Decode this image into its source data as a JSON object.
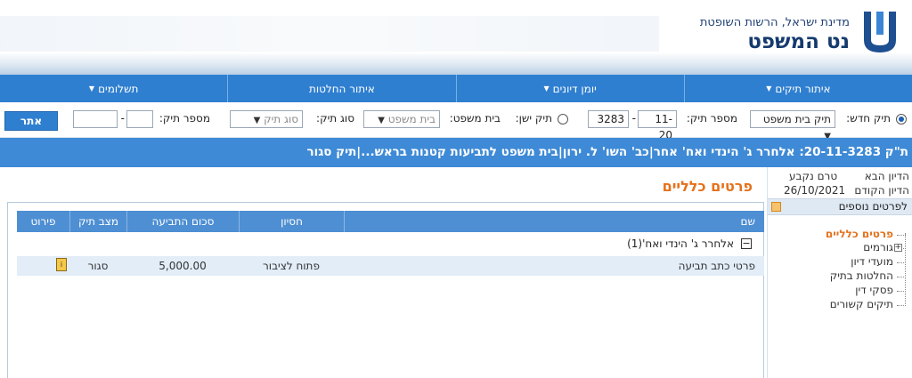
{
  "header": {
    "authority": "מדינת ישראל, הרשות השופטת",
    "site_name": "נט המשפט",
    "logo_icon": "court-logo-icon"
  },
  "nav": {
    "items": [
      {
        "label": "איתור תיקים",
        "dropdown": true
      },
      {
        "label": "יומן דיונים",
        "dropdown": true
      },
      {
        "label": "איתור החלטות",
        "dropdown": false
      },
      {
        "label": "תשלומים",
        "dropdown": true
      }
    ]
  },
  "search": {
    "new_case_label": "תיק חדש:",
    "new_case_selected": true,
    "court_type_value": "תיק בית משפט",
    "case_number_label": "מספר תיק:",
    "case_number_value": "11-20",
    "case_number_suffix": "3283",
    "old_case_label": "תיק ישן:",
    "court_label": "בית משפט:",
    "court_placeholder": "בית משפט",
    "case_type_label": "סוג תיק:",
    "case_type_placeholder": "סוג תיק",
    "case_number2_label": "מספר תיק:",
    "search_button": "אתר"
  },
  "case_bar": {
    "title": "ת\"ק 20-11-3283: אלחרר ג' הינדי ואח' אחר|כב' השו' ל. ירון|בית משפט לתביעות קטנות בראש...|תיק סגור"
  },
  "side": {
    "next_hearing_label": "הדיון הבא",
    "next_hearing_value": "טרם נקבע",
    "prev_hearing_label": "הדיון הקודם",
    "prev_hearing_value": "26/10/2021",
    "more_details": "לפרטים נוספים",
    "tree": [
      {
        "label": "פרטים כלליים",
        "active": true,
        "expandable": false
      },
      {
        "label": "גורמים",
        "active": false,
        "expandable": true
      },
      {
        "label": "מועדי דיון",
        "active": false,
        "expandable": false
      },
      {
        "label": "החלטות בתיק",
        "active": false,
        "expandable": false
      },
      {
        "label": "פסקי דין",
        "active": false,
        "expandable": false
      },
      {
        "label": "תיקים קשורים",
        "active": false,
        "expandable": false
      }
    ]
  },
  "main": {
    "title": "פרטים כלליים",
    "columns": {
      "name": "שם",
      "privilege": "חסיון",
      "amount": "סכום התביעה",
      "status": "מצב תיק",
      "detail": "פירוט"
    },
    "group": {
      "label": "אלחרר ג' הינדי ואח'(1)"
    },
    "rows": [
      {
        "name": "פרטי כתב תביעה",
        "privilege": "פתוח לציבור",
        "amount": "5,000.00",
        "status": "סגור"
      }
    ]
  }
}
